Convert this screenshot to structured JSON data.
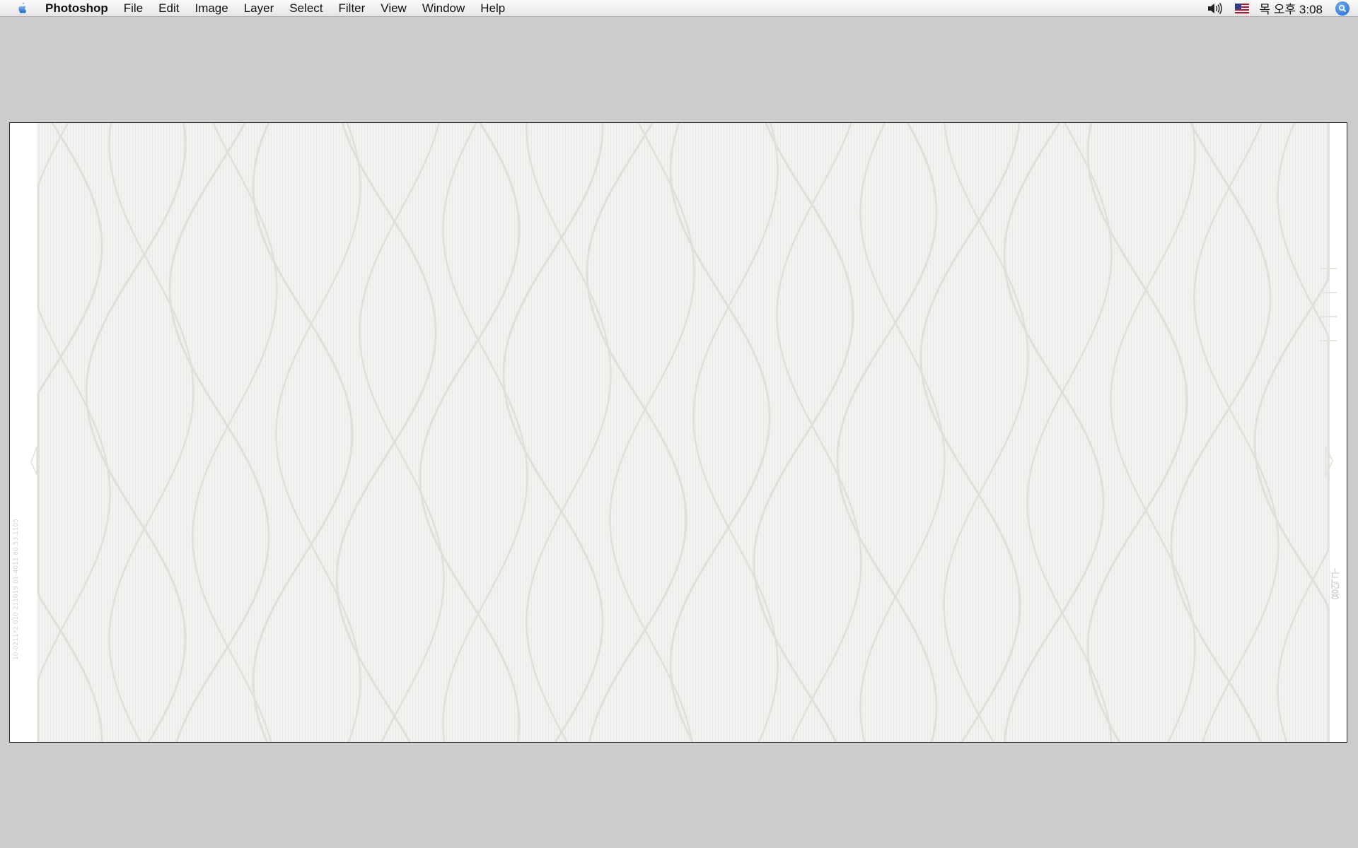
{
  "menubar": {
    "apple_icon": "apple-logo-icon",
    "app_name": "Photoshop",
    "items": [
      "File",
      "Edit",
      "Image",
      "Layer",
      "Select",
      "Filter",
      "View",
      "Window",
      "Help"
    ],
    "status": {
      "volume_icon": "speaker-volume-icon",
      "input_flag_icon": "us-flag-icon",
      "clock": "목 오후 3:08",
      "spotlight_icon": "spotlight-search-icon"
    }
  },
  "document": {
    "left_margin_text": "10-0211*2.010 211019 01-4011 80.53.1105",
    "right_margin_text": "용덕구"
  },
  "colors": {
    "desktop_background": "#cccccc",
    "canvas_background": "#f1f1ef",
    "wave_line": "#e0e0da"
  }
}
